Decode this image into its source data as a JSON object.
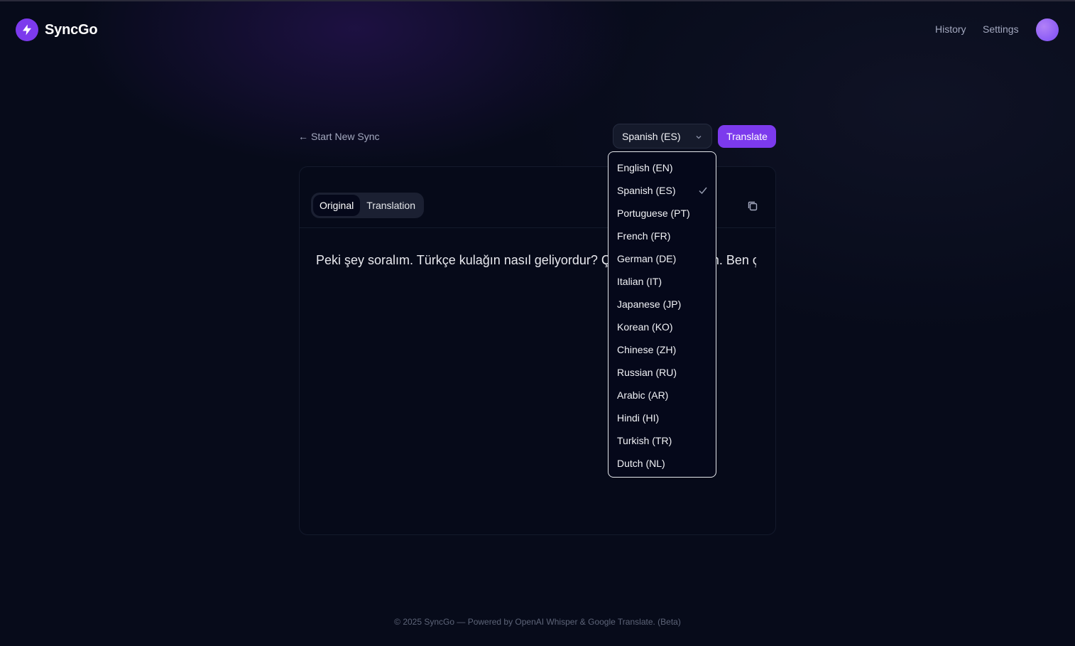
{
  "app": {
    "name": "SyncGo"
  },
  "header": {
    "nav": {
      "history": "History",
      "settings": "Settings"
    }
  },
  "controls": {
    "back_label": "Start New Sync",
    "back_arrow": "←",
    "selected_language": "Spanish (ES)",
    "translate_label": "Translate"
  },
  "card": {
    "tabs": [
      {
        "label": "Original",
        "active": true
      },
      {
        "label": "Translation",
        "active": false
      }
    ],
    "text": "Peki şey soralım. Türkçe kulağın nasıl geliyordur? Çok merak ediyorum. Ben çok ... ağım."
  },
  "dropdown": {
    "options": [
      "English (EN)",
      "Spanish (ES)",
      "Portuguese (PT)",
      "French (FR)",
      "German (DE)",
      "Italian (IT)",
      "Japanese (JP)",
      "Korean (KO)",
      "Chinese (ZH)",
      "Russian (RU)",
      "Arabic (AR)",
      "Hindi (HI)",
      "Turkish (TR)",
      "Dutch (NL)"
    ],
    "selected_index": 1
  },
  "footer": {
    "text": "© 2025 SyncGo — Powered by OpenAI Whisper & Google Translate. (Beta)"
  },
  "colors": {
    "accent": "#7c3aed",
    "avatar": "#8b5cf6",
    "background": "#070b1a"
  },
  "icons": {
    "logo": "lightning-bolt-icon",
    "select": "chevron-down-icon",
    "copy": "copy-icon",
    "selected": "check-icon"
  }
}
